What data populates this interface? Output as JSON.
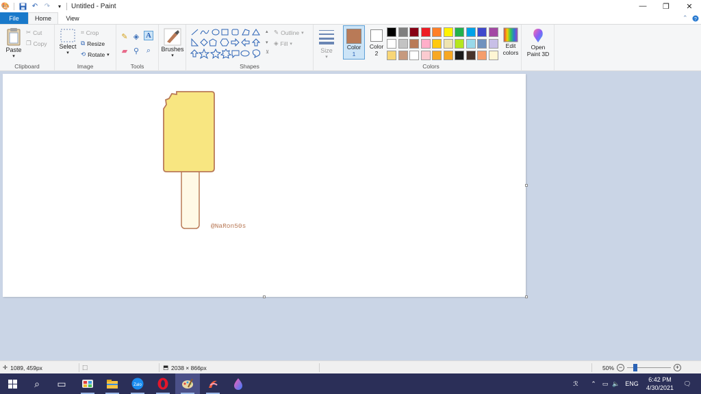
{
  "window": {
    "title": "Untitled - Paint",
    "controls": {
      "minimize": "—",
      "restore": "❐",
      "close": "✕"
    }
  },
  "tabs": [
    {
      "label": "File"
    },
    {
      "label": "Home"
    },
    {
      "label": "View"
    }
  ],
  "ribbon": {
    "clipboard": {
      "label": "Clipboard",
      "paste": "Paste",
      "cut": "Cut",
      "copy": "Copy"
    },
    "image": {
      "label": "Image",
      "select": "Select",
      "crop": "Crop",
      "resize": "Resize",
      "rotate": "Rotate"
    },
    "tools": {
      "label": "Tools"
    },
    "brushes": {
      "label": "Brushes"
    },
    "shapes": {
      "label": "Shapes",
      "outline": "Outline",
      "fill": "Fill"
    },
    "size": {
      "label": "Size"
    },
    "colors": {
      "label": "Colors",
      "color1_label": "Color",
      "color1_num": "1",
      "color2_label": "Color",
      "color2_num": "2",
      "color1": "#b97a57",
      "color2": "#ffffff",
      "palette_row1": [
        "#000000",
        "#7f7f7f",
        "#880015",
        "#ed1c24",
        "#ff7f27",
        "#fff200",
        "#22b14c",
        "#00a2e8",
        "#3f48cc",
        "#a349a4"
      ],
      "palette_row2": [
        "#ffffff",
        "#c3c3c3",
        "#b97a57",
        "#ffaec9",
        "#ffc90e",
        "#efe4b0",
        "#b5e61d",
        "#99d9ea",
        "#7092be",
        "#c8bfe7"
      ],
      "palette_row3": [
        "#f8d677",
        "#c69a7f",
        "#ffffff",
        "#fbcbd0",
        "#f7a823",
        "#f7a823",
        "#1b1b1b",
        "#47332a",
        "#f59d6b",
        "#fff6d4"
      ],
      "edit_colors_line1": "Edit",
      "edit_colors_line2": "colors"
    },
    "paint3d": {
      "line1": "Open",
      "line2": "Paint 3D"
    }
  },
  "canvas": {
    "watermark": "@NaRon50s",
    "popsicle_color": "#f8e681",
    "stick_color": "#fff9e6",
    "outline_color": "#b97a57"
  },
  "status": {
    "cursor_pos": "1089, 459px",
    "image_size": "2038 × 866px",
    "zoom": "50%",
    "zoom_level": 0.5
  },
  "taskbar": {
    "lang": "ENG",
    "time": "6:42 PM",
    "date": "4/30/2021",
    "zalo": "Zalo"
  }
}
